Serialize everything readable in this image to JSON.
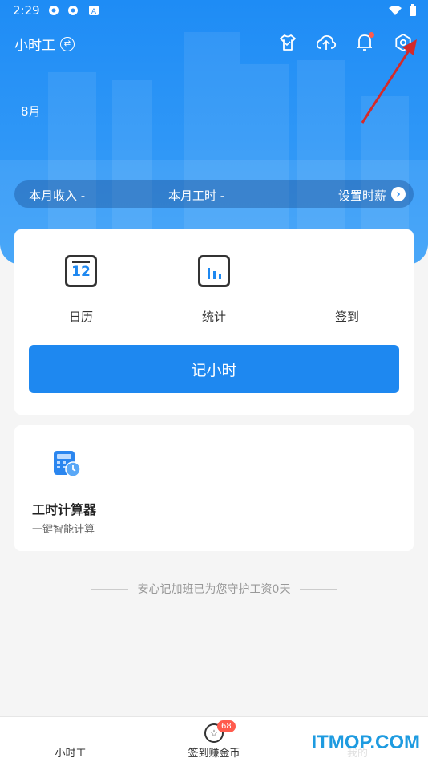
{
  "status_bar": {
    "time": "2:29"
  },
  "header": {
    "app_title": "小时工"
  },
  "hero": {
    "month": "8月",
    "income_label": "本月收入 -",
    "hours_label": "本月工时 -",
    "set_wage_label": "设置时薪"
  },
  "features": [
    {
      "label": "日历",
      "icon": "calendar-icon",
      "number": "12"
    },
    {
      "label": "统计",
      "icon": "chart-icon"
    },
    {
      "label": "签到",
      "icon": "checkin-icon"
    }
  ],
  "record_button": "记小时",
  "tool": {
    "title": "工时计算器",
    "subtitle": "一键智能计算",
    "icon": "calculator-clock-icon"
  },
  "guard_text": "安心记加班已为您守护工资0天",
  "tabbar": {
    "tabs": [
      {
        "label": "小时工"
      },
      {
        "label": "签到赚金币",
        "badge": "68"
      },
      {
        "label": "我的"
      }
    ]
  },
  "watermark": "ITMOP.COM",
  "colors": {
    "primary": "#1e88f0",
    "badge": "#ff5b4d",
    "annotation_arrow": "#d42a2a"
  }
}
